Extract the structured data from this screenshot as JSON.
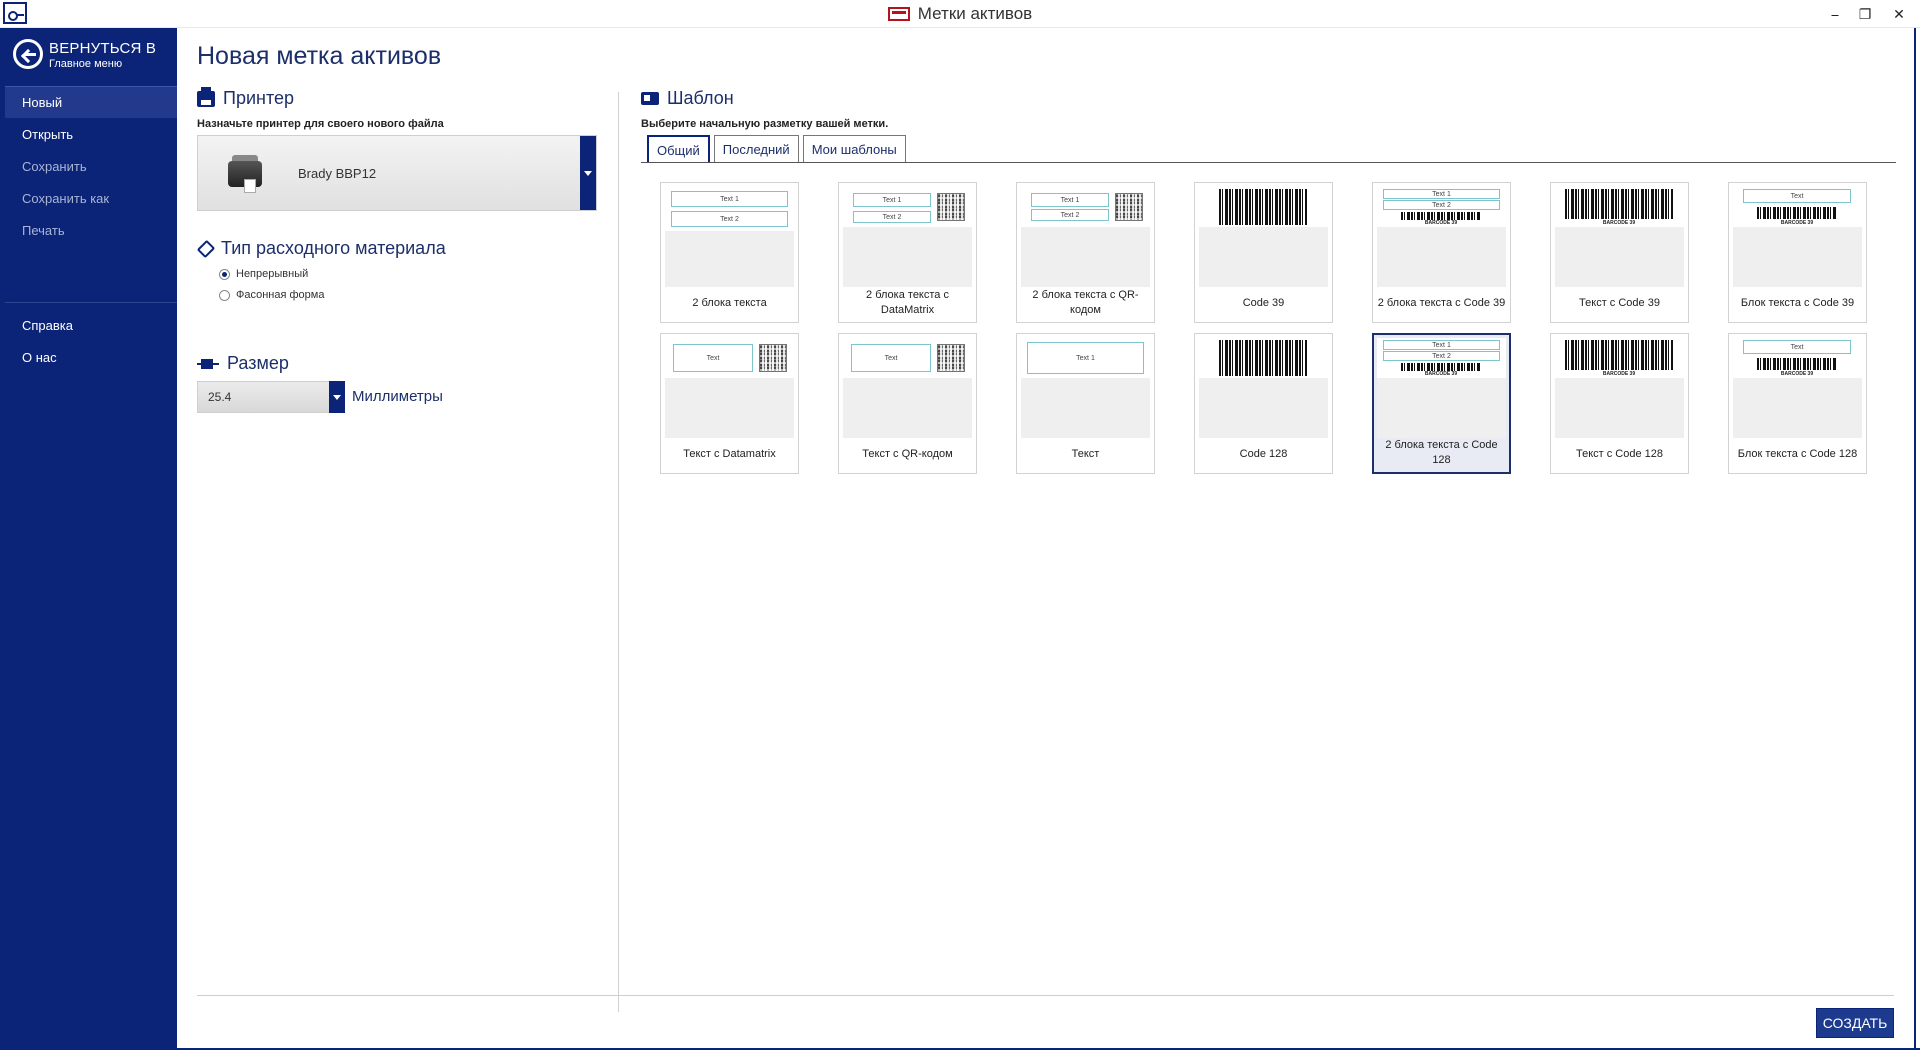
{
  "window": {
    "title": "Метки активов",
    "minimize": "⎯",
    "maximize": "❐",
    "close": "✕"
  },
  "sidebar": {
    "back_title": "ВЕРНУТЬСЯ В",
    "back_subtitle": "Главное меню",
    "items": [
      {
        "label": "Новый",
        "state": "active"
      },
      {
        "label": "Открыть",
        "state": "normal"
      },
      {
        "label": "Сохранить",
        "state": "disabled"
      },
      {
        "label": "Сохранить как",
        "state": "disabled"
      },
      {
        "label": "Печать",
        "state": "disabled"
      }
    ],
    "items2": [
      {
        "label": "Справка"
      },
      {
        "label": "О нас"
      }
    ]
  },
  "page_title": "Новая метка активов",
  "printer": {
    "heading": "Принтер",
    "description": "Назначьте принтер для своего нового файла",
    "selected": "Brady BBP12"
  },
  "supply": {
    "heading": "Тип расходного материала",
    "options": [
      {
        "label": "Непрерывный",
        "selected": true
      },
      {
        "label": "Фасонная форма",
        "selected": false
      }
    ]
  },
  "size": {
    "heading": "Размер",
    "value": "25.4",
    "unit": "Миллиметры"
  },
  "template": {
    "heading": "Шаблон",
    "description": "Выберите начальную разметку вашей метки.",
    "tabs": [
      {
        "label": "Общий",
        "active": true
      },
      {
        "label": "Последний",
        "active": false
      },
      {
        "label": "Мои шаблоны",
        "active": false
      }
    ],
    "preview_text": {
      "text1": "Text 1",
      "text2": "Text 2",
      "text": "Text",
      "barcode39": "BARCODE 39"
    },
    "items": [
      {
        "label": "2 блока текста",
        "selected": false
      },
      {
        "label": "2 блока текста с DataMatrix",
        "selected": false
      },
      {
        "label": "2 блока текста с QR-кодом",
        "selected": false
      },
      {
        "label": "Code 39",
        "selected": false
      },
      {
        "label": "2 блока текста с Code 39",
        "selected": false
      },
      {
        "label": "Текст с Code 39",
        "selected": false
      },
      {
        "label": "Блок текста с Code 39",
        "selected": false
      },
      {
        "label": "Текст с Datamatrix",
        "selected": false
      },
      {
        "label": "Текст с QR-кодом",
        "selected": false
      },
      {
        "label": "Текст",
        "selected": false
      },
      {
        "label": "Code 128",
        "selected": false
      },
      {
        "label": "2 блока текста с Code 128",
        "selected": true
      },
      {
        "label": "Текст с Code 128",
        "selected": false
      },
      {
        "label": "Блок текста с Code 128",
        "selected": false
      }
    ]
  },
  "create_button": "СОЗДАТЬ"
}
